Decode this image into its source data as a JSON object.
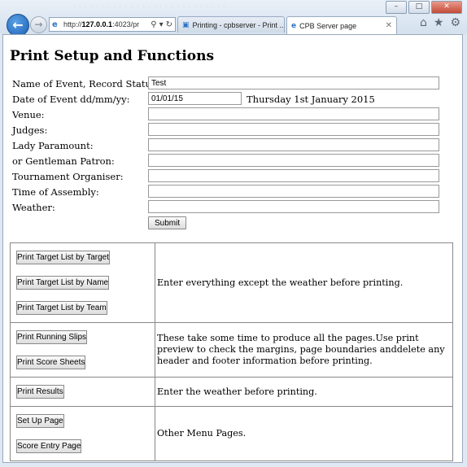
{
  "browser": {
    "url_prefix": "http://",
    "url_host": "127.0.0.1",
    "url_rest": ":4023/pr",
    "tabs": [
      {
        "label": "Printing - cpbserver - Print ..."
      },
      {
        "label": "CPB Server page"
      }
    ]
  },
  "page": {
    "title": "Print Setup and Functions",
    "fields": [
      {
        "label": "Name of Event, Record Status:",
        "value": "Test"
      },
      {
        "label": "Date of Event dd/mm/yy:",
        "value": "01/01/15",
        "extra": "Thursday 1st January 2015"
      },
      {
        "label": "Venue:",
        "value": ""
      },
      {
        "label": "Judges:",
        "value": ""
      },
      {
        "label": "Lady Paramount:",
        "value": ""
      },
      {
        "label": "or Gentleman Patron:",
        "value": ""
      },
      {
        "label": "Tournament Organiser:",
        "value": ""
      },
      {
        "label": "Time of Assembly:",
        "value": ""
      },
      {
        "label": "Weather:",
        "value": ""
      }
    ],
    "submit_label": "Submit",
    "sections": [
      {
        "buttons": [
          "Print Target List by Target",
          "Print Target List by Name",
          "Print Target List by Team"
        ],
        "note": "Enter everything except the weather before printing."
      },
      {
        "buttons": [
          "Print Running Slips",
          "Print Score Sheets"
        ],
        "note": "These take some time to produce all the pages.Use print preview to check the margins, page boundaries anddelete any header and footer information before printing."
      },
      {
        "buttons": [
          "Print Results"
        ],
        "note": "Enter the weather before printing."
      },
      {
        "buttons": [
          "Set Up Page",
          "Score Entry Page"
        ],
        "note": "Other Menu Pages."
      }
    ]
  }
}
